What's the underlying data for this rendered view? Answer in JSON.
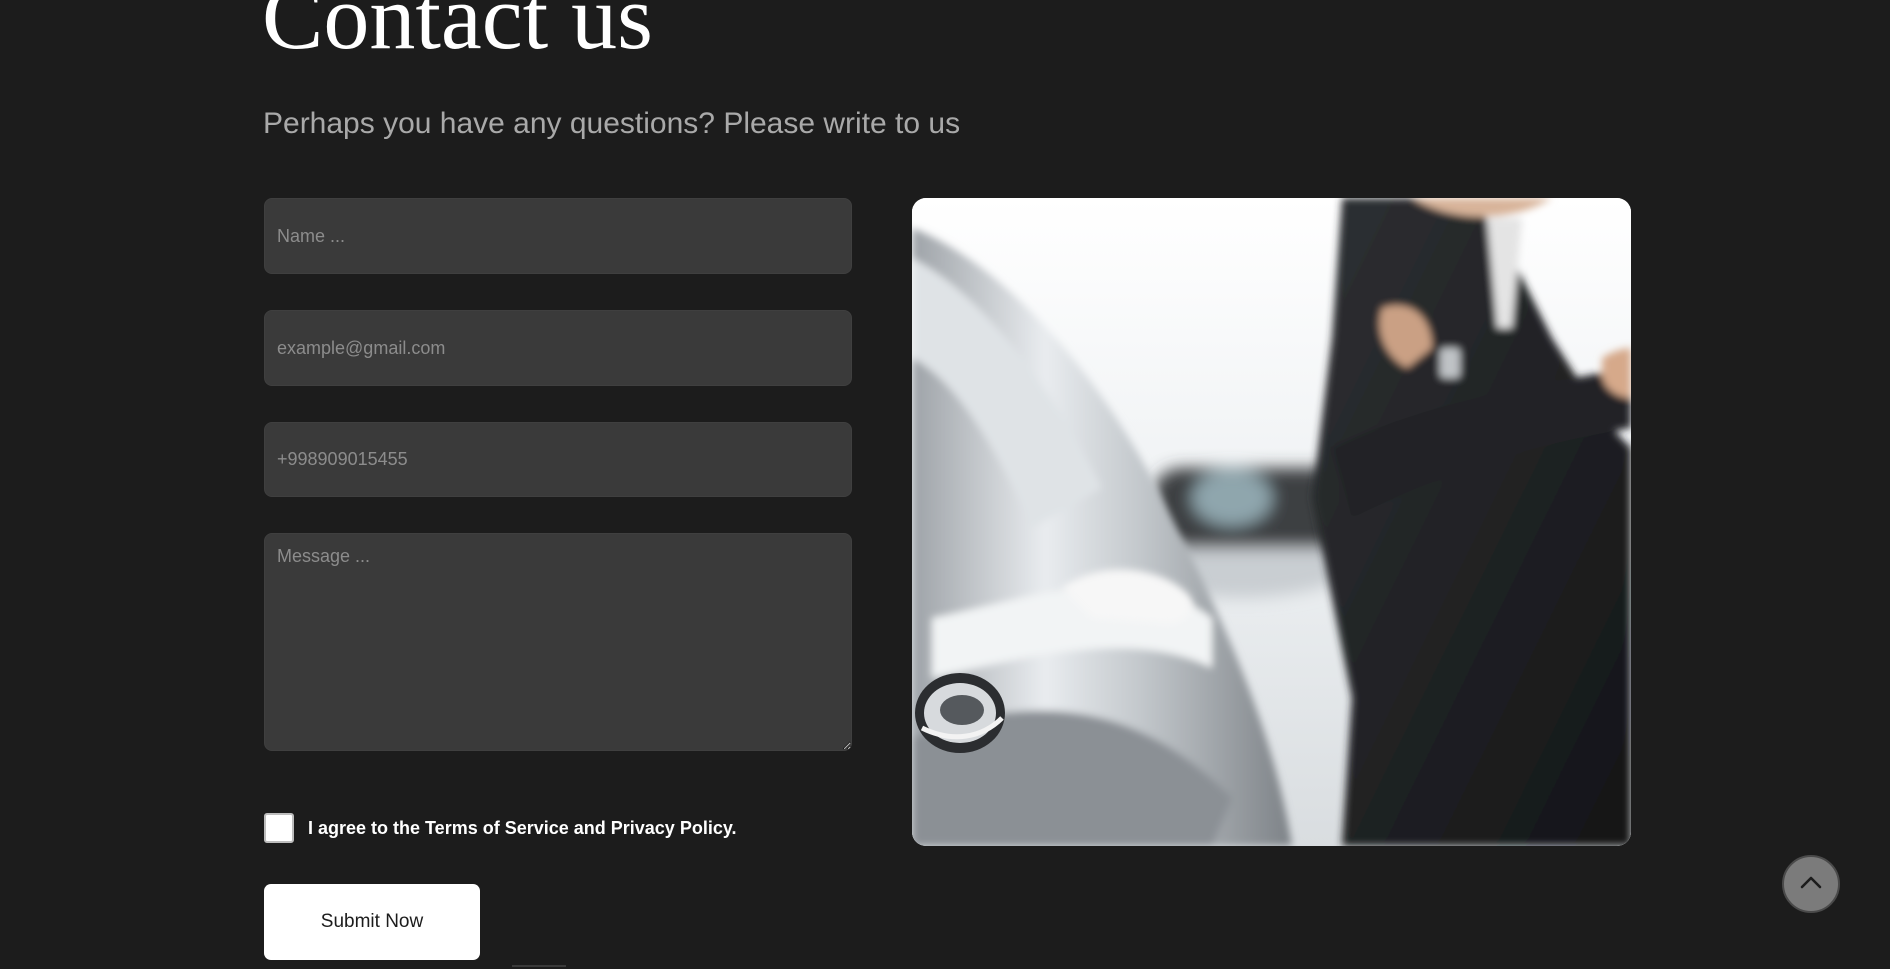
{
  "header": {
    "title": "Contact us",
    "subtitle": "Perhaps you have any questions? Please write to us"
  },
  "form": {
    "name_placeholder": "Name ...",
    "email_placeholder": "example@gmail.com",
    "phone_placeholder": "+998909015455",
    "message_placeholder": "Message ...",
    "agree_label": "I agree to the Terms of Service and Privacy Policy.",
    "agree_checked": false,
    "submit_label": "Submit Now"
  },
  "image": {
    "subject": "chauffeur in black suit beside silver car",
    "icon": "photo"
  },
  "scroll_top": {
    "icon": "chevron-up-icon"
  },
  "colors": {
    "background": "#1c1c1c",
    "field_background": "#3a3a3a",
    "placeholder": "#8c8c8c",
    "subtitle": "#a9a9a9",
    "button_background": "#ffffff"
  }
}
